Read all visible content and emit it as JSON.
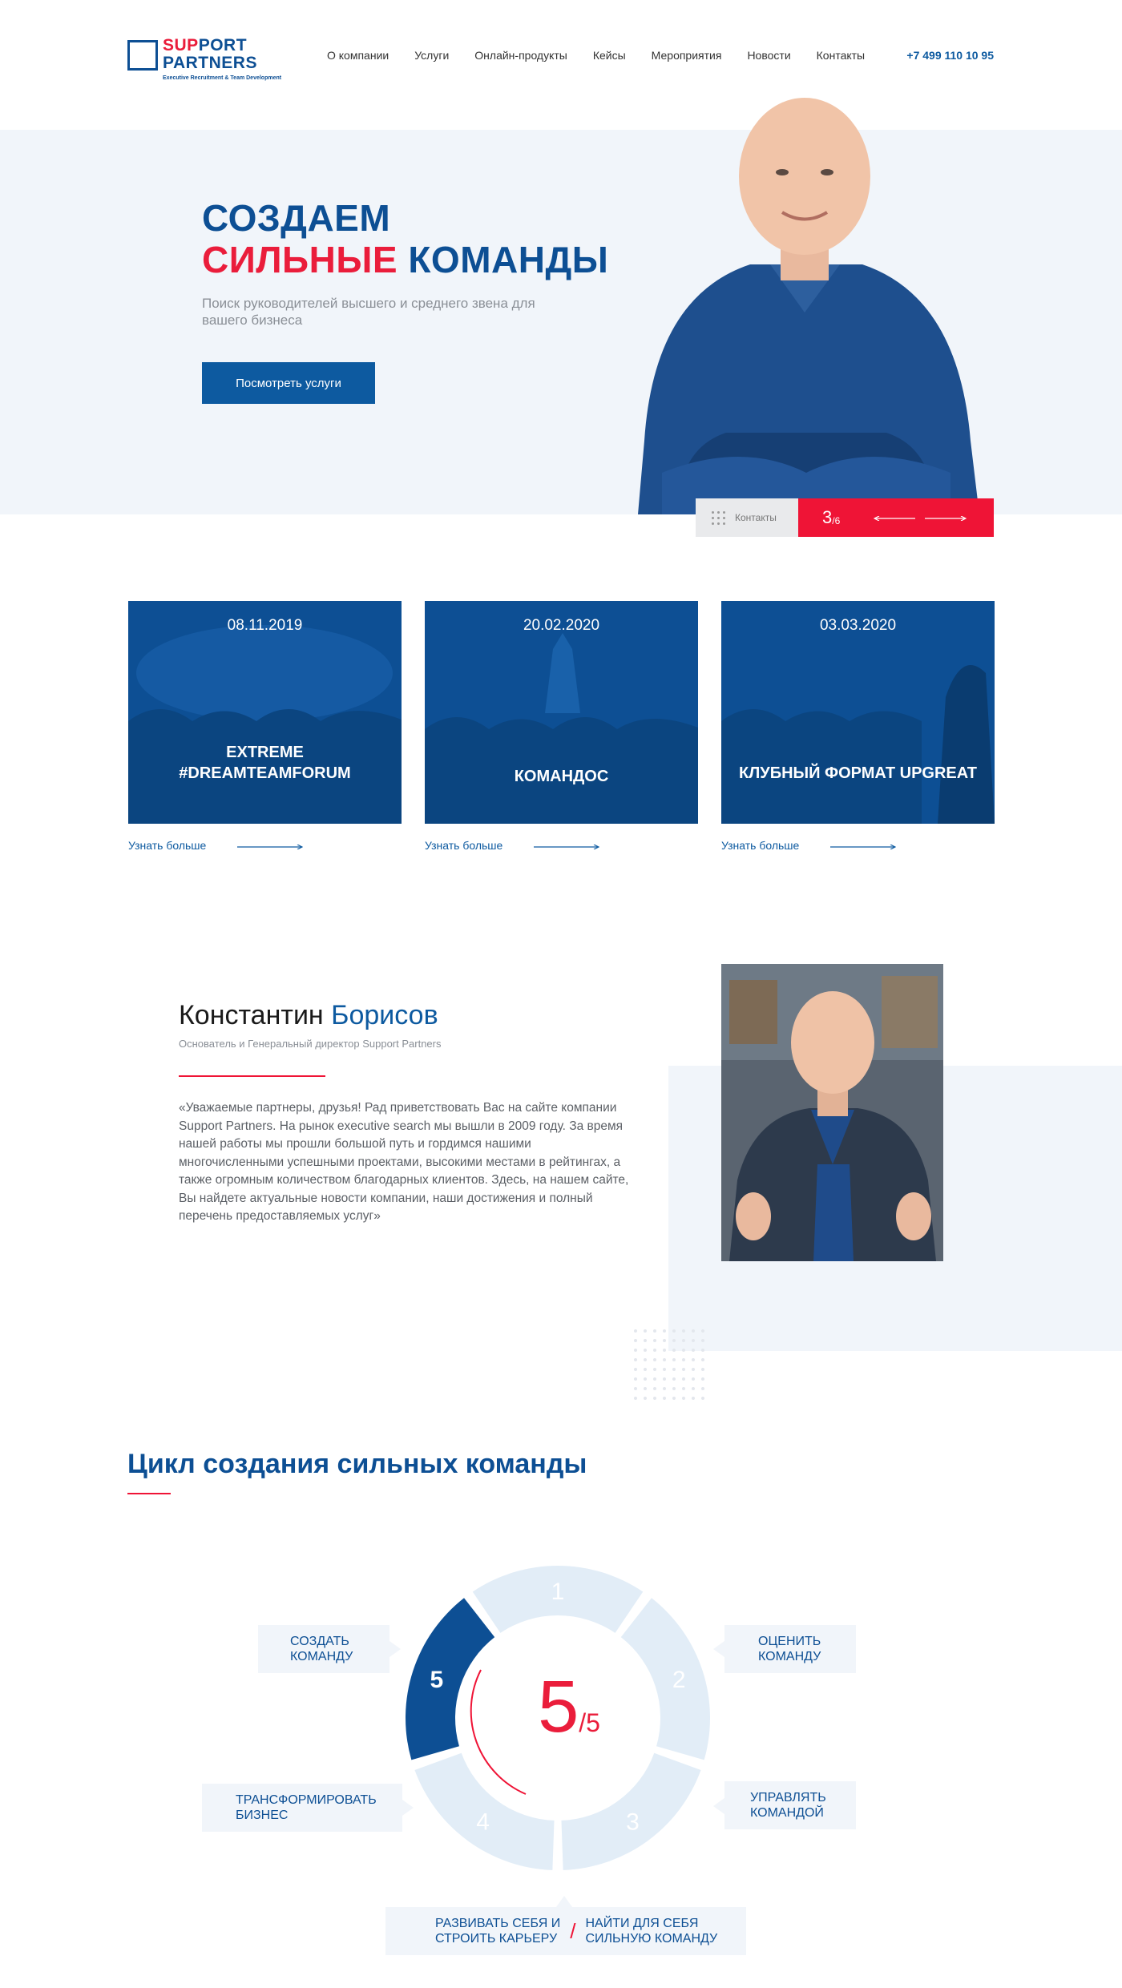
{
  "header": {
    "logo": {
      "line1_a": "SUP",
      "line1_b": "PORT",
      "line2": "PARTNERS",
      "tagline": "Executive Recruitment & Team Development"
    },
    "nav": [
      "О компании",
      "Услуги",
      "Онлайн-продукты",
      "Кейсы",
      "Мероприятия",
      "Новости",
      "Контакты"
    ],
    "phone": "+7 499 110 10 95"
  },
  "hero": {
    "title_line1": "СОЗДАЕМ",
    "title_line2_red": "СИЛЬНЫЕ",
    "title_line2_blue": " КОМАНДЫ",
    "subtitle": "Поиск руководителей высшего и среднего звена для вашего бизнеса",
    "button_label": "Посмотреть услуги",
    "slider": {
      "contacts_label": "Контакты",
      "current": "3",
      "total": "/6"
    }
  },
  "events": [
    {
      "date": "08.11.2019",
      "title_line1": "EXTREME",
      "title_line2": "#DREAMTEAMFORUM",
      "link": "Узнать больше"
    },
    {
      "date": "20.02.2020",
      "title_line1": "КОМАНДОС",
      "title_line2": "",
      "link": "Узнать больше"
    },
    {
      "date": "03.03.2020",
      "title_line1": "КЛУБНЫЙ ФОРМАТ UPGREAT",
      "title_line2": "",
      "link": "Узнать больше"
    }
  ],
  "founder": {
    "first_name": "Константин",
    "last_name": " Борисов",
    "role": "Основатель и Генеральный директор Support Partners",
    "quote": "«Уважаемые партнеры, друзья! Рад приветствовать Вас на сайте компании Support Partners. На рынок executive search мы вышли в 2009 году. За время нашей работы мы прошли большой путь и гордимся нашими многочисленными успешными проектами, высокими местами в рейтингах, а также огромным количеством благодарных клиентов. Здесь, на нашем сайте, Вы найдете актуальные новости компании, наши достижения и полный перечень предоставляемых услуг»"
  },
  "cycle": {
    "title": "Цикл создания сильных команды",
    "current": "5",
    "total": "/5",
    "segments": [
      "1",
      "2",
      "3",
      "4",
      "5"
    ],
    "active_segment": 5,
    "steps": {
      "s1_line1": "СОЗДАТЬ",
      "s1_line2": "КОМАНДУ",
      "s2_line1": "ОЦЕНИТЬ",
      "s2_line2": "КОМАНДУ",
      "s3_line1": "УПРАВЛЯТЬ",
      "s3_line2": "КОМАНДОЙ",
      "s4a_line1": "РАЗВИВАТЬ СЕБЯ И",
      "s4a_line2": "СТРОИТЬ КАРЬЕРУ",
      "s4b_line1": "НАЙТИ ДЛЯ СЕБЯ",
      "s4b_line2": "СИЛЬНУЮ КОМАНДУ",
      "s5_line1": "ТРАНСФОРМИРОВАТЬ",
      "s5_line2": "БИЗНЕС"
    }
  },
  "colors": {
    "brand_blue": "#0d4f94",
    "accent_red": "#ef1436",
    "light_bg": "#f1f5fa"
  }
}
